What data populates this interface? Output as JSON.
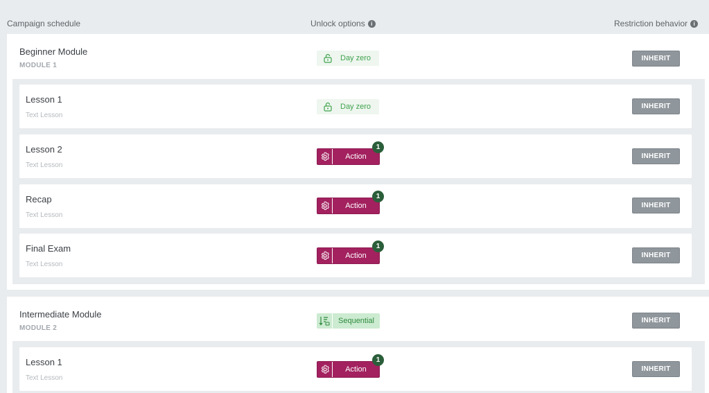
{
  "header": {
    "col_schedule": "Campaign schedule",
    "col_unlock": "Unlock options",
    "col_restriction": "Restriction behavior",
    "info_glyph": "i"
  },
  "modules": [
    {
      "title": "Beginner Module",
      "subtitle": "MODULE 1",
      "unlock": {
        "type": "day",
        "label": "Day zero"
      },
      "restriction": "INHERIT",
      "lessons": [
        {
          "title": "Lesson 1",
          "subtitle": "Text Lesson",
          "unlock": {
            "type": "day",
            "label": "Day zero"
          },
          "restriction": "INHERIT"
        },
        {
          "title": "Lesson 2",
          "subtitle": "Text Lesson",
          "unlock": {
            "type": "action",
            "label": "Action",
            "count": "1"
          },
          "restriction": "INHERIT"
        },
        {
          "title": "Recap",
          "subtitle": "Text Lesson",
          "unlock": {
            "type": "action",
            "label": "Action",
            "count": "1"
          },
          "restriction": "INHERIT"
        },
        {
          "title": "Final Exam",
          "subtitle": "Text Lesson",
          "unlock": {
            "type": "action",
            "label": "Action",
            "count": "1"
          },
          "restriction": "INHERIT"
        }
      ]
    },
    {
      "title": "Intermediate Module",
      "subtitle": "MODULE 2",
      "unlock": {
        "type": "sequential",
        "label": "Sequential"
      },
      "restriction": "INHERIT",
      "lessons": [
        {
          "title": "Lesson 1",
          "subtitle": "Text Lesson",
          "unlock": {
            "type": "action",
            "label": "Action",
            "count": "1"
          },
          "restriction": "INHERIT"
        }
      ]
    }
  ],
  "colors": {
    "action": "#a3215f",
    "day_zero_text": "#3fa34d",
    "sequential_bg": "#ccebd1",
    "badge": "#2b5e3a",
    "inherit": "#8f969c"
  },
  "icons": {
    "day": "unlock-icon",
    "action": "gear-icon",
    "sequential": "sort-sequential-icon",
    "info": "info-icon"
  }
}
